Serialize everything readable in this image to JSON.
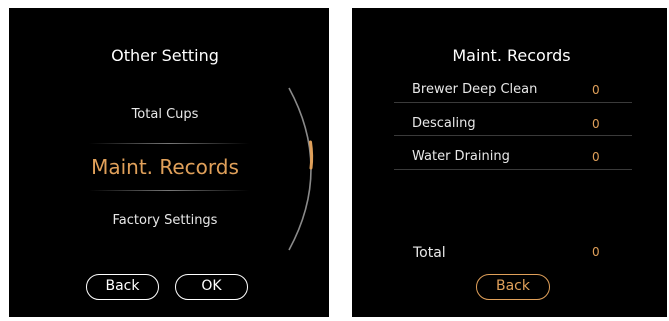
{
  "left_screen": {
    "title": "Other Setting",
    "menu": {
      "item_1": "Total Cups",
      "item_selected": "Maint. Records",
      "item_3": "Factory Settings"
    },
    "buttons": {
      "back": "Back",
      "ok": "OK"
    }
  },
  "right_screen": {
    "title": "Maint. Records",
    "records": [
      {
        "label": "Brewer Deep Clean",
        "value": "0"
      },
      {
        "label": "Descaling",
        "value": "0"
      },
      {
        "label": "Water Draining",
        "value": "0"
      }
    ],
    "total": {
      "label": "Total",
      "value": "0"
    },
    "buttons": {
      "back": "Back"
    }
  },
  "colors": {
    "accent": "#e0a05a",
    "background": "#000000",
    "text": "#ffffff"
  }
}
